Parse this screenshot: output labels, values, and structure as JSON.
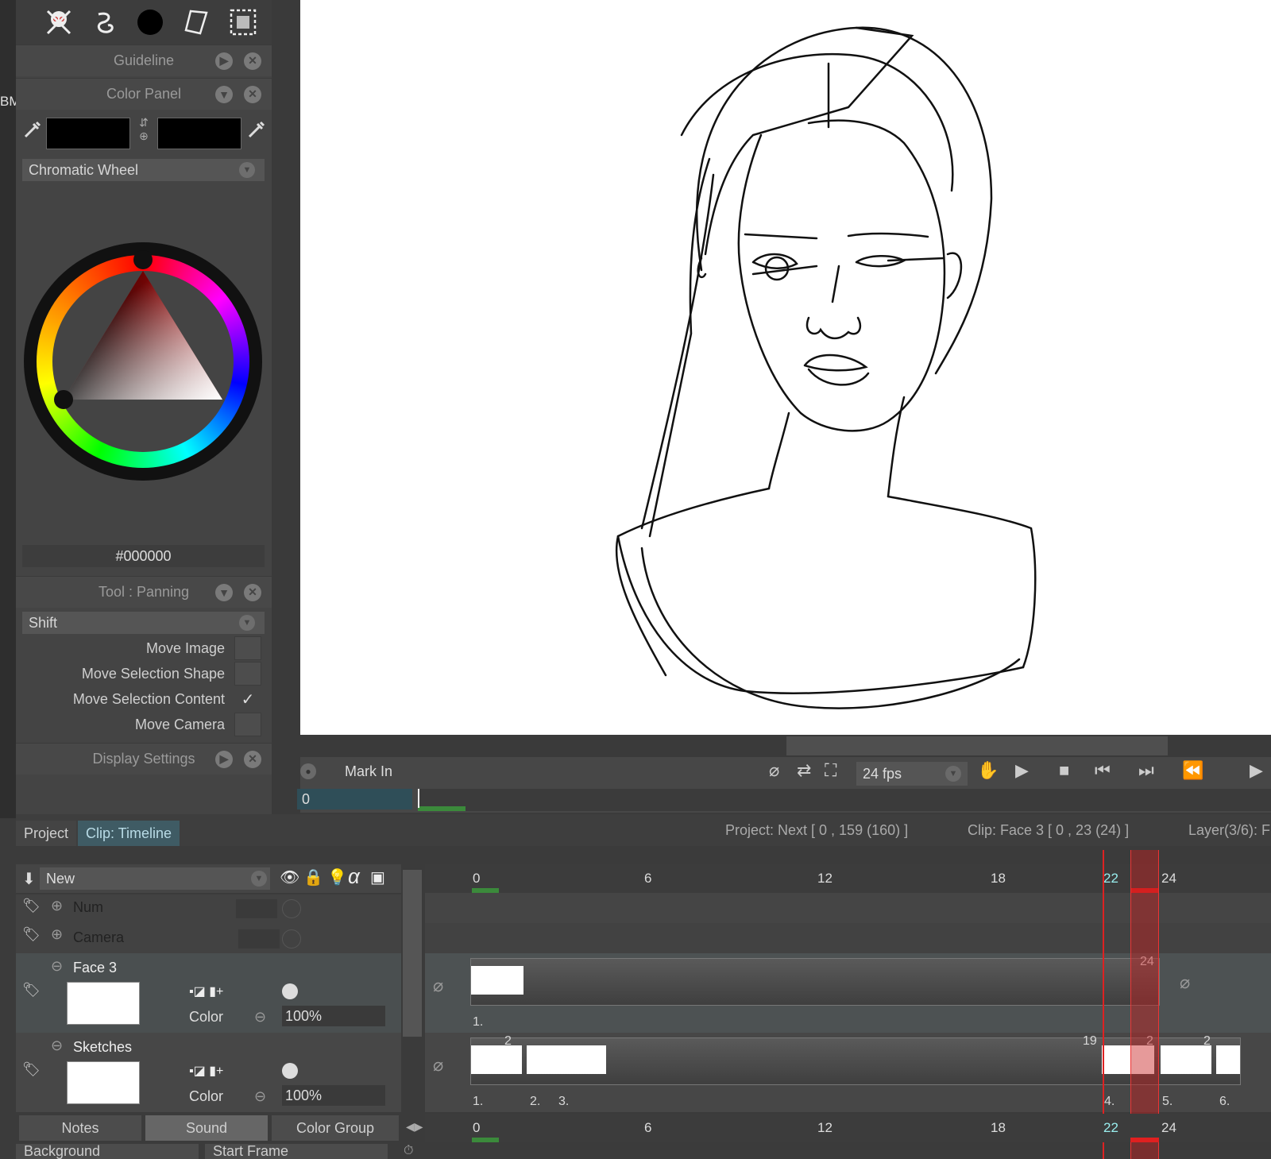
{
  "left_fragment": "BM",
  "toolbar": {
    "icons": [
      "skull-icon",
      "swirl-icon",
      "brush-dot-icon",
      "paper-icon",
      "selection-icon"
    ]
  },
  "panels": {
    "guideline": "Guideline",
    "color_panel": "Color Panel",
    "tool": "Tool : Panning",
    "display_settings": "Display Settings"
  },
  "color": {
    "mode": "Chromatic Wheel",
    "hex": "#000000",
    "foreground": "#000000",
    "background": "#000000"
  },
  "tool_options": {
    "modifier": "Shift",
    "items": [
      {
        "label": "Move Image",
        "checked": false
      },
      {
        "label": "Move Selection Shape",
        "checked": false
      },
      {
        "label": "Move Selection Content",
        "checked": true
      },
      {
        "label": "Move Camera",
        "checked": false
      }
    ]
  },
  "transport": {
    "mark_in": "Mark In",
    "frame_value": "0",
    "fps": "24 fps"
  },
  "timeline_tabs": {
    "project": "Project",
    "clip": "Clip: Timeline"
  },
  "status": {
    "project": "Project: Next [ 0 , 159  (160) ]",
    "clip": "Clip: Face 3 [ 0 , 23  (24) ]",
    "layer": "Layer(3/6): F"
  },
  "layers": {
    "new_label": "New",
    "rows": [
      {
        "name": "Num"
      },
      {
        "name": "Camera"
      },
      {
        "name": "Face 3",
        "blend": "Color",
        "opacity": "100%"
      },
      {
        "name": "Sketches",
        "blend": "Color",
        "opacity": "100%"
      }
    ]
  },
  "ruler": {
    "labels": [
      "0",
      "6",
      "12",
      "18",
      "22",
      "24"
    ]
  },
  "tracks": {
    "face3": {
      "end_label": "24",
      "cel_labels": [
        "1."
      ]
    },
    "sketches": {
      "labels_top": [
        "2",
        "19",
        "2",
        "2"
      ],
      "cel_labels": [
        "1.",
        "2.",
        "3.",
        "4.",
        "5.",
        "6."
      ]
    }
  },
  "bottom_tabs": [
    "Notes",
    "Sound",
    "Color Group"
  ],
  "bottom_fields": {
    "background": "Background",
    "start_frame": "Start Frame"
  }
}
